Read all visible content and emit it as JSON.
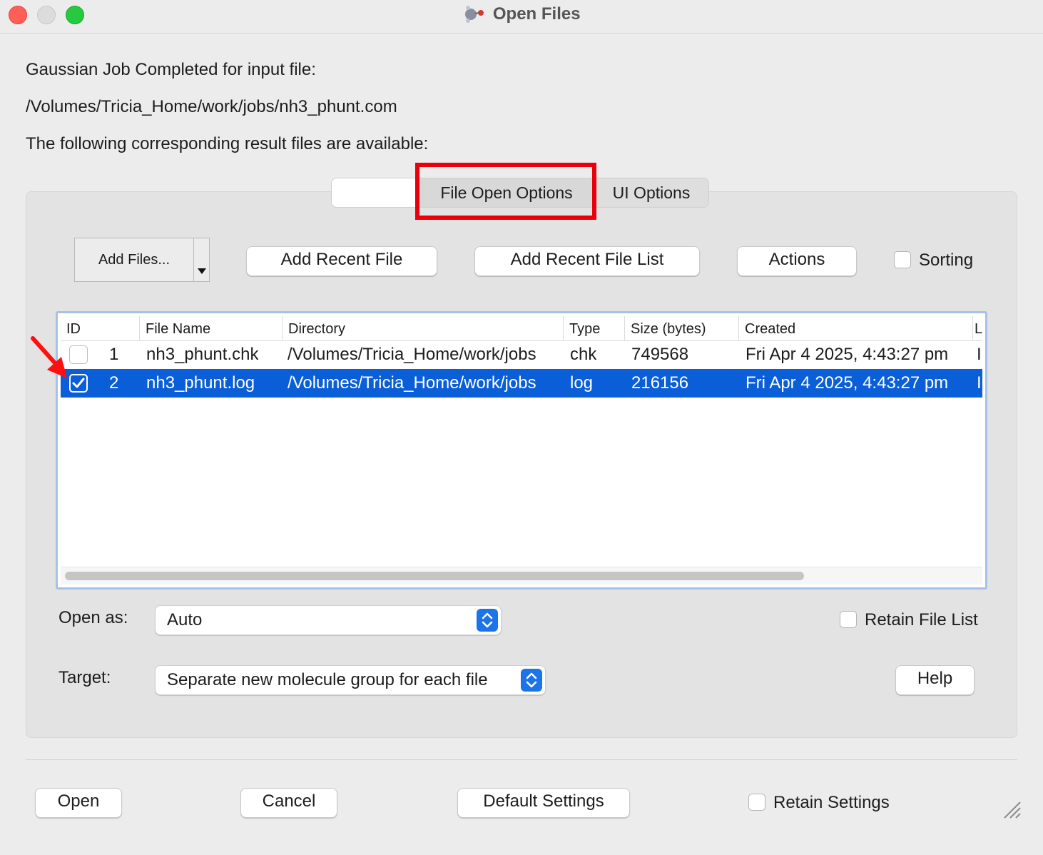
{
  "window": {
    "title": "Open Files",
    "app_icon": "gaussview-molecule-icon"
  },
  "info": {
    "line1": "Gaussian Job Completed for input file:",
    "input_path": "/Volumes/Tricia_Home/work/jobs/nh3_phunt.com",
    "line3": "The following corresponding result files are available:"
  },
  "tabs": {
    "blank": "",
    "file_open_options": "File Open Options",
    "ui_options": "UI Options"
  },
  "toolbar": {
    "add_files": "Add Files...",
    "add_recent_file": "Add Recent File",
    "add_recent_file_list": "Add Recent File List",
    "actions": "Actions",
    "sorting": "Sorting"
  },
  "table": {
    "columns": [
      "ID",
      "File Name",
      "Directory",
      "Type",
      "Size (bytes)",
      "Created",
      "L"
    ],
    "rows": [
      {
        "id": "1",
        "file_name": "nh3_phunt.chk",
        "directory": "/Volumes/Tricia_Home/work/jobs",
        "type": "chk",
        "size": "749568",
        "created": "Fri Apr 4 2025, 4:43:27 pm",
        "last": "I",
        "checked": false,
        "selected": false
      },
      {
        "id": "2",
        "file_name": "nh3_phunt.log",
        "directory": "/Volumes/Tricia_Home/work/jobs",
        "type": "log",
        "size": "216156",
        "created": "Fri Apr 4 2025, 4:43:27 pm",
        "last": "I",
        "checked": true,
        "selected": true
      }
    ]
  },
  "options": {
    "open_as_label": "Open as:",
    "open_as_value": "Auto",
    "retain_file_list": "Retain File List",
    "target_label": "Target:",
    "target_value": "Separate new molecule group for each file",
    "help": "Help"
  },
  "footer": {
    "open": "Open",
    "cancel": "Cancel",
    "default_settings": "Default Settings",
    "retain_settings": "Retain Settings"
  },
  "colors": {
    "selection": "#0a5ed7",
    "highlight_annotation": "#e8000b",
    "stepper": "#1b74ea"
  }
}
